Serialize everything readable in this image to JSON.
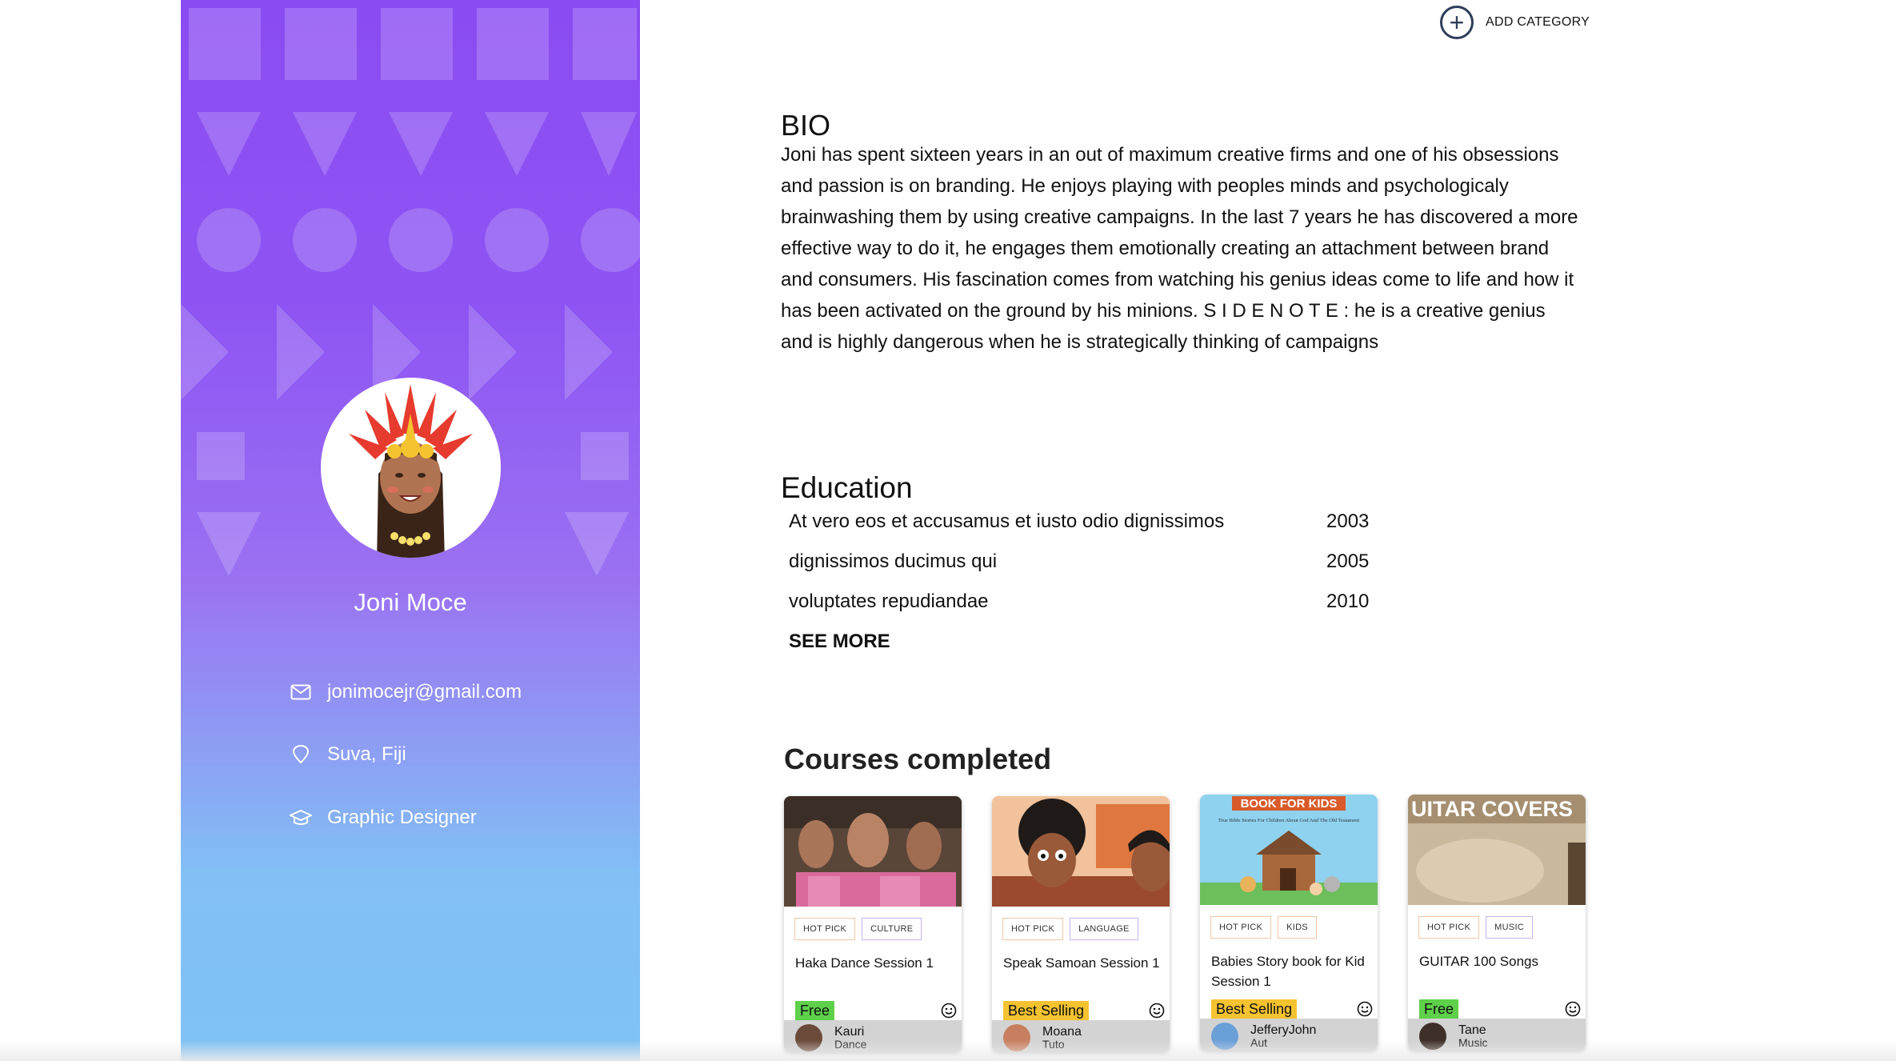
{
  "profile": {
    "name": "Joni Moce",
    "email": "jonimocejr@gmail.com",
    "location": "Suva, Fiji",
    "occupation": "Graphic Designer"
  },
  "header": {
    "add_category_label": "ADD CATEGORY"
  },
  "bio": {
    "title": "BIO",
    "text": "Joni has spent sixteen years in an out of maximum creative firms and one of his obsessions and passion is on branding. He enjoys playing with peoples minds and psychologicaly brainwashing them by using creative campaigns. In the last 7 years he has discovered a more effective way to do it, he engages them emotionally creating an attachment between brand and consumers. His fascination comes from watching his genius ideas come to life and how it has been activated on the ground by his minions. S I D E N O T E : he is a creative genius and is highly dangerous when he is strategically thinking of campaigns"
  },
  "education": {
    "title": "Education",
    "rows": [
      {
        "label": "At vero eos et accusamus et iusto odio dignissimos",
        "year": "2003"
      },
      {
        "label": "dignissimos ducimus qui",
        "year": "2005"
      },
      {
        "label": "voluptates repudiandae",
        "year": "2010"
      }
    ],
    "see_more": "SEE MORE"
  },
  "courses": {
    "title": "Courses completed",
    "cards": [
      {
        "thumb_text": "",
        "tag1": "HOT PICK",
        "tag2": "CULTURE",
        "title": "Haka Dance Session 1",
        "price": "Free",
        "instructor": "Kauri",
        "instructor_sub": "Dance"
      },
      {
        "thumb_text": "",
        "tag1": "HOT PICK",
        "tag2": "LANGUAGE",
        "title": "Speak Samoan Session 1",
        "price": "Best Selling",
        "instructor": "Moana",
        "instructor_sub": "Tuto"
      },
      {
        "thumb_text": "BOOK FOR KIDS",
        "thumb_sub": "True Bible Stories For Children About God And The Old Testament",
        "tag1": "HOT PICK",
        "tag2": "KIDS",
        "title": "Babies Story book for Kid Session 1",
        "price": "Best Selling",
        "instructor": "JefferyJohn",
        "instructor_sub": "Aut"
      },
      {
        "thumb_text": "UITAR COVERS",
        "tag1": "HOT PICK",
        "tag2": "MUSIC",
        "title": "GUITAR 100 Songs",
        "price": "Free",
        "instructor": "Tane",
        "instructor_sub": "Music"
      }
    ]
  },
  "colors": {
    "panel_top": "#8a4cf2",
    "panel_bottom": "#7fc2f5",
    "badge_free": "#5ed04a",
    "badge_best": "#f5c330"
  },
  "icons": [
    "mail-icon",
    "location-pin-icon",
    "graduation-cap-icon",
    "plus-circle-icon",
    "smiley-icon"
  ]
}
